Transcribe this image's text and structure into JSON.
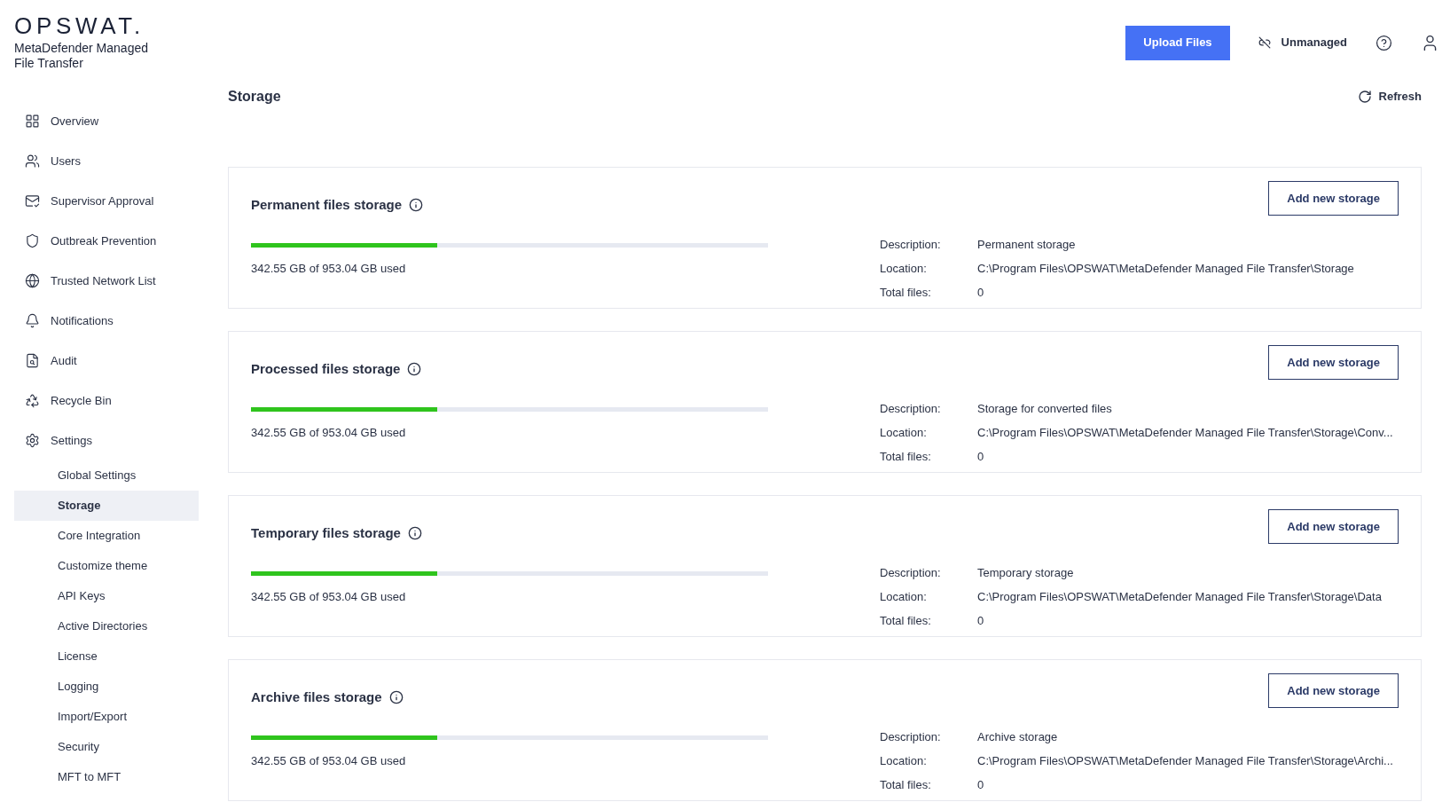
{
  "logo": {
    "wordmark": "OPSWAT.",
    "product": "MetaDefender Managed File Transfer"
  },
  "header": {
    "upload_button": "Upload Files",
    "status": "Unmanaged"
  },
  "sidebar": {
    "items": [
      {
        "label": "Overview",
        "selected": false
      },
      {
        "label": "Users",
        "selected": false
      },
      {
        "label": "Supervisor Approval",
        "selected": false
      },
      {
        "label": "Outbreak Prevention",
        "selected": false
      },
      {
        "label": "Trusted Network List",
        "selected": false
      },
      {
        "label": "Notifications",
        "selected": false
      },
      {
        "label": "Audit",
        "selected": false
      },
      {
        "label": "Recycle Bin",
        "selected": false
      },
      {
        "label": "Settings",
        "selected": false,
        "children": [
          {
            "label": "Global Settings",
            "selected": false
          },
          {
            "label": "Storage",
            "selected": true
          },
          {
            "label": "Core Integration",
            "selected": false
          },
          {
            "label": "Customize theme",
            "selected": false
          },
          {
            "label": "API Keys",
            "selected": false
          },
          {
            "label": "Active Directories",
            "selected": false
          },
          {
            "label": "License",
            "selected": false
          },
          {
            "label": "Logging",
            "selected": false
          },
          {
            "label": "Import/Export",
            "selected": false
          },
          {
            "label": "Security",
            "selected": false
          },
          {
            "label": "MFT to MFT",
            "selected": false
          }
        ]
      }
    ]
  },
  "page": {
    "title": "Storage",
    "refresh": "Refresh"
  },
  "storages": [
    {
      "title": "Permanent files storage",
      "level": 0.36,
      "usage": "342.55 GB of 953.04 GB used",
      "button": "Add new storage",
      "details": [
        {
          "label": "Description:",
          "value": "Permanent storage"
        },
        {
          "label": "Location:",
          "value": "C:\\Program Files\\OPSWAT\\MetaDefender Managed File Transfer\\Storage"
        },
        {
          "label": "Total files:",
          "value": "0"
        }
      ]
    },
    {
      "title": "Processed files storage",
      "level": 0.36,
      "usage": "342.55 GB of 953.04 GB used",
      "button": "Add new storage",
      "details": [
        {
          "label": "Description:",
          "value": "Storage for converted files"
        },
        {
          "label": "Location:",
          "value": "C:\\Program Files\\OPSWAT\\MetaDefender Managed File Transfer\\Storage\\Conv..."
        },
        {
          "label": "Total files:",
          "value": "0"
        }
      ]
    },
    {
      "title": "Temporary files storage",
      "level": 0.36,
      "usage": "342.55 GB of 953.04 GB used",
      "button": "Add new storage",
      "details": [
        {
          "label": "Description:",
          "value": "Temporary storage"
        },
        {
          "label": "Location:",
          "value": "C:\\Program Files\\OPSWAT\\MetaDefender Managed File Transfer\\Storage\\Data"
        },
        {
          "label": "Total files:",
          "value": "0"
        }
      ]
    },
    {
      "title": "Archive files storage",
      "level": 0.36,
      "usage": "342.55 GB of 953.04 GB used",
      "button": "Add new storage",
      "details": [
        {
          "label": "Description:",
          "value": "Archive storage"
        },
        {
          "label": "Location:",
          "value": "C:\\Program Files\\OPSWAT\\MetaDefender Managed File Transfer\\Storage\\Archi..."
        },
        {
          "label": "Total files:",
          "value": "0"
        }
      ]
    }
  ]
}
